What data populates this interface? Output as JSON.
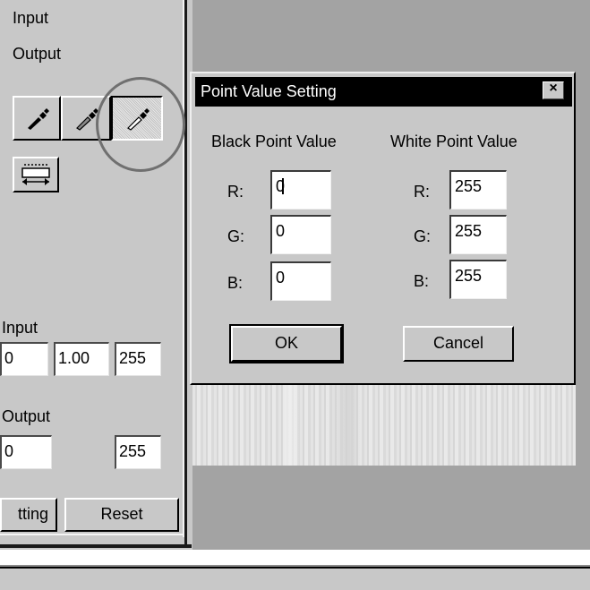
{
  "left_panel": {
    "input_label_top": "Input",
    "output_label_top": "Output",
    "input_label": "Input",
    "input_values": [
      "0",
      "1.00",
      "255"
    ],
    "output_label": "Output",
    "output_values": [
      "0",
      "255"
    ],
    "setting_button": "tting",
    "reset_button": "Reset"
  },
  "dialog": {
    "title": "Point Value Setting",
    "close_glyph": "×",
    "black_header": "Black Point Value",
    "white_header": "White Point Value",
    "rows": [
      {
        "label": "R:",
        "black": "0",
        "white": "255"
      },
      {
        "label": "G:",
        "black": "0",
        "white": "255"
      },
      {
        "label": "B:",
        "black": "0",
        "white": "255"
      }
    ],
    "ok_button": "OK",
    "cancel_button": "Cancel"
  },
  "icons": {
    "tools": [
      "black-eyedropper-icon",
      "gray-eyedropper-icon",
      "white-eyedropper-icon",
      "auto-range-icon"
    ]
  },
  "colors": {
    "panel": "#c8c8c8",
    "workspace": "#a3a3a3",
    "titlebar": "#000000",
    "highlight_circle": "#707070"
  }
}
